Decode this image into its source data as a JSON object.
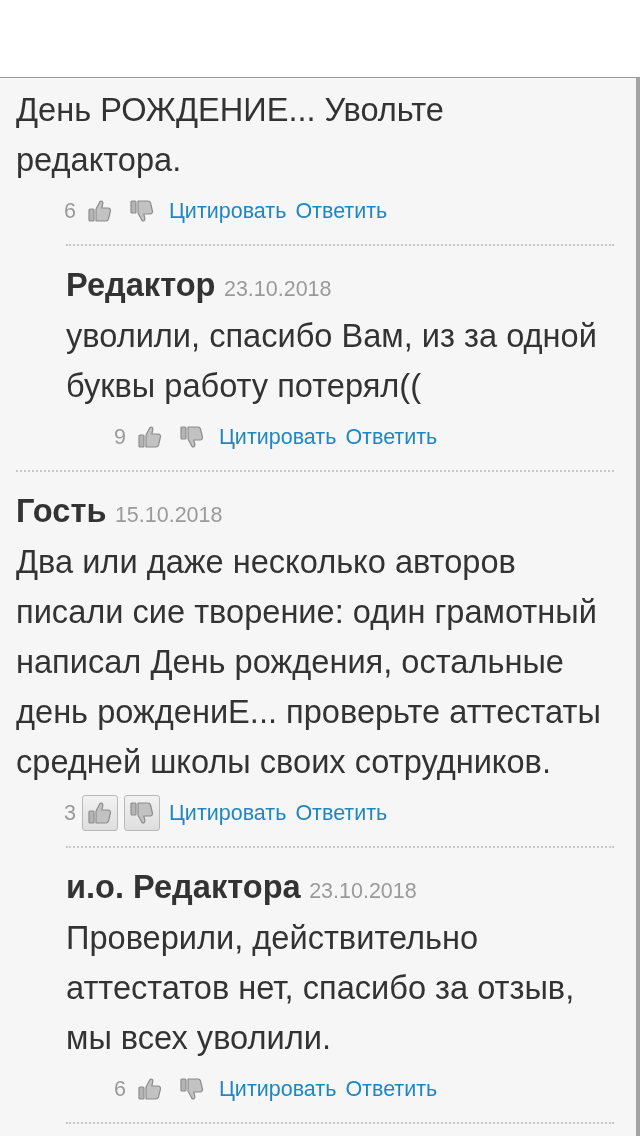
{
  "comments": [
    {
      "text": "День РОЖДЕНИЕ... Увольте редактора.",
      "rating": "6",
      "voting_active": false,
      "quote_link": "Цитировать",
      "reply_link": "Ответить",
      "replies": [
        {
          "author": "Редактор",
          "date": "23.10.2018",
          "text": "уволили, спасибо Вам, из за одной буквы работу потерял((",
          "rating": "9",
          "voting_active": false,
          "quote_link": "Цитировать",
          "reply_link": "Ответить"
        }
      ]
    },
    {
      "author": "Гость",
      "date": "15.10.2018",
      "text": "Два или даже несколько авторов писали сие творение: один грамотный написал День рождения, остальные день рождениЕ... проверьте аттестаты средней школы своих сотрудников.",
      "rating": "3",
      "voting_active": true,
      "quote_link": "Цитировать",
      "reply_link": "Ответить",
      "replies": [
        {
          "author": "и.о. Редактора",
          "date": "23.10.2018",
          "text": "Проверили, действительно аттестатов нет, спасибо за отзыв, мы всех уволили.",
          "rating": "6",
          "voting_active": false,
          "quote_link": "Цитировать",
          "reply_link": "Ответить"
        }
      ]
    }
  ]
}
